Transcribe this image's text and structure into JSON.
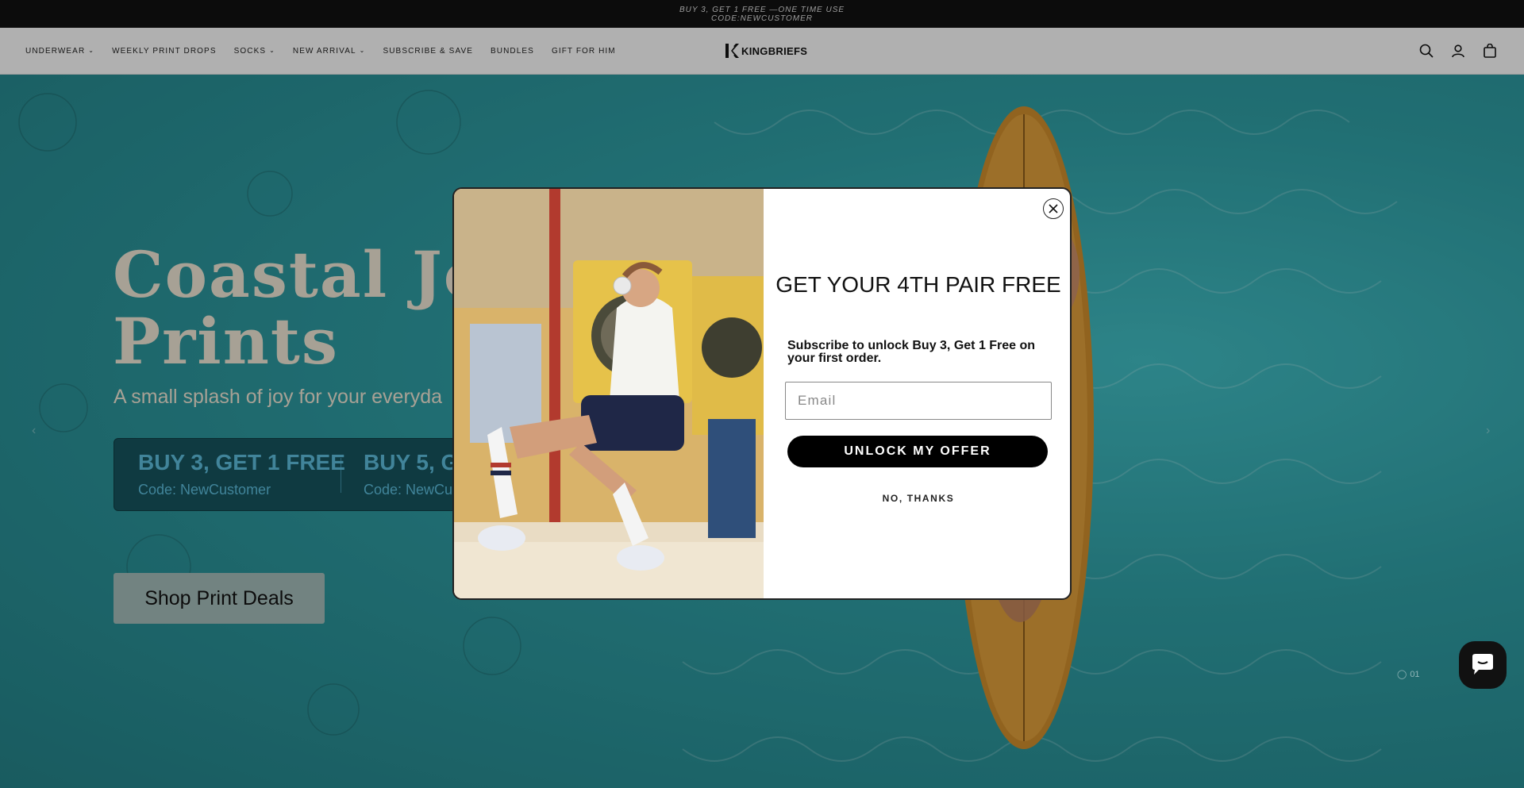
{
  "announcement": {
    "line1": "BUY 3, GET 1 FREE —ONE TIME USE",
    "line2": "CODE:NEWCUSTOMER"
  },
  "header": {
    "nav": [
      {
        "label": "UNDERWEAR",
        "dropdown": true
      },
      {
        "label": "WEEKLY PRINT DROPS",
        "dropdown": false
      },
      {
        "label": "SOCKS",
        "dropdown": true
      },
      {
        "label": "NEW ARRIVAL",
        "dropdown": true
      },
      {
        "label": "SUBSCRIBE & SAVE",
        "dropdown": false
      },
      {
        "label": "BUNDLES",
        "dropdown": false
      },
      {
        "label": "GIFT FOR HIM",
        "dropdown": false
      }
    ],
    "logo_text": "KINGBRIEFS",
    "icons": [
      "search-icon",
      "account-icon",
      "cart-icon"
    ]
  },
  "hero": {
    "title_line1": "Coastal Joy",
    "title_line2": "Prints",
    "subtitle": "A small splash of joy for your everyda",
    "offer1_title": "BUY 3, GET 1 FREE",
    "offer1_code": "Code: NewCustomer",
    "offer2_title": "BUY 5, G",
    "offer2_code": "Code: NewCu",
    "cta": "Shop Print Deals",
    "slide_counter": "01"
  },
  "modal": {
    "heading": "GET YOUR 4TH PAIR FREE",
    "subtext": "Subscribe to unlock Buy 3, Get 1 Free on your first order.",
    "email_placeholder": "Email",
    "submit_label": "UNLOCK MY OFFER",
    "decline_label": "NO, THANKS"
  },
  "colors": {
    "announce_bg": "#111111",
    "header_bg": "#f4f4f4",
    "hero_water": "#2e9aa0",
    "offer_text": "#5ab8d6",
    "button_black": "#000000"
  }
}
